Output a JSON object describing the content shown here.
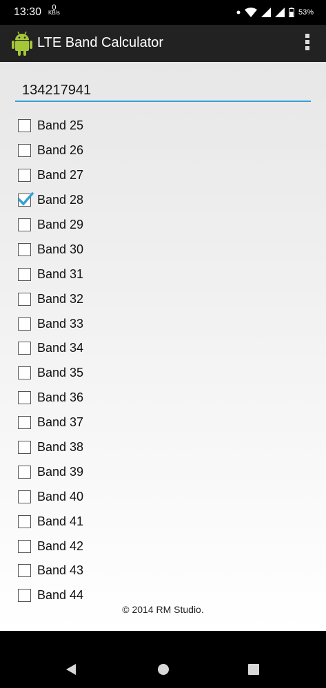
{
  "status_bar": {
    "time": "13:30",
    "net_speed_value": "0",
    "net_speed_unit": "KB/s",
    "battery_percent": "53%"
  },
  "app_bar": {
    "title": "LTE Band Calculator"
  },
  "input": {
    "value": "134217941"
  },
  "bands": [
    {
      "label": "Band 25",
      "checked": false
    },
    {
      "label": "Band 26",
      "checked": false
    },
    {
      "label": "Band 27",
      "checked": false
    },
    {
      "label": "Band 28",
      "checked": true
    },
    {
      "label": "Band 29",
      "checked": false
    },
    {
      "label": "Band 30",
      "checked": false
    },
    {
      "label": "Band 31",
      "checked": false
    },
    {
      "label": "Band 32",
      "checked": false
    },
    {
      "label": "Band 33",
      "checked": false
    },
    {
      "label": "Band 34",
      "checked": false
    },
    {
      "label": "Band 35",
      "checked": false
    },
    {
      "label": "Band 36",
      "checked": false
    },
    {
      "label": "Band 37",
      "checked": false
    },
    {
      "label": "Band 38",
      "checked": false
    },
    {
      "label": "Band 39",
      "checked": false
    },
    {
      "label": "Band 40",
      "checked": false
    },
    {
      "label": "Band 41",
      "checked": false
    },
    {
      "label": "Band 42",
      "checked": false
    },
    {
      "label": "Band 43",
      "checked": false
    },
    {
      "label": "Band 44",
      "checked": false
    }
  ],
  "footer": {
    "copyright": "© 2014 RM Studio."
  },
  "colors": {
    "accent": "#33a0d8",
    "app_bar": "#222222",
    "android_green": "#a4c639"
  },
  "icons": {
    "app": "android-robot-icon",
    "menu": "overflow-menu-icon",
    "nav_back": "back-triangle-icon",
    "nav_home": "home-circle-icon",
    "nav_recents": "recents-square-icon"
  }
}
